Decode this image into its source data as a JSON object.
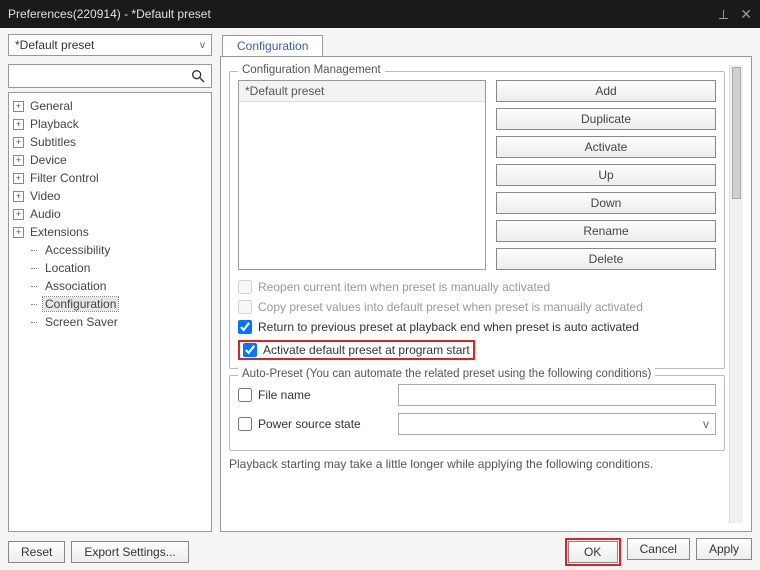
{
  "window": {
    "title": "Preferences(220914) - *Default preset"
  },
  "left": {
    "preset_selected": "*Default preset",
    "search_placeholder": "",
    "tree": [
      {
        "label": "General",
        "expandable": true
      },
      {
        "label": "Playback",
        "expandable": true
      },
      {
        "label": "Subtitles",
        "expandable": true
      },
      {
        "label": "Device",
        "expandable": true
      },
      {
        "label": "Filter Control",
        "expandable": true
      },
      {
        "label": "Video",
        "expandable": true
      },
      {
        "label": "Audio",
        "expandable": true
      },
      {
        "label": "Extensions",
        "expandable": true,
        "expanded": false
      },
      {
        "label": "Accessibility",
        "child": true
      },
      {
        "label": "Location",
        "child": true
      },
      {
        "label": "Association",
        "child": true
      },
      {
        "label": "Configuration",
        "child": true,
        "selected": true
      },
      {
        "label": "Screen Saver",
        "child": true
      }
    ]
  },
  "right": {
    "tab_label": "Configuration",
    "mgmt_legend": "Configuration Management",
    "preset_list": [
      "*Default preset"
    ],
    "buttons": {
      "add": "Add",
      "duplicate": "Duplicate",
      "activate": "Activate",
      "up": "Up",
      "down": "Down",
      "rename": "Rename",
      "delete": "Delete"
    },
    "checks": {
      "reopen": "Reopen current item when preset is manually activated",
      "copy": "Copy preset values into default preset when preset is manually activated",
      "return": "Return to previous preset at playback end when preset is auto activated",
      "activate_default": "Activate default preset at program start"
    },
    "auto_legend": "Auto-Preset (You can automate the related preset using the following conditions)",
    "auto_filename": "File name",
    "auto_power": "Power source state",
    "auto_power_chev": "v",
    "note": "Playback starting may take a little longer while applying the following conditions."
  },
  "footer": {
    "reset": "Reset",
    "export": "Export Settings...",
    "ok": "OK",
    "cancel": "Cancel",
    "apply": "Apply"
  }
}
